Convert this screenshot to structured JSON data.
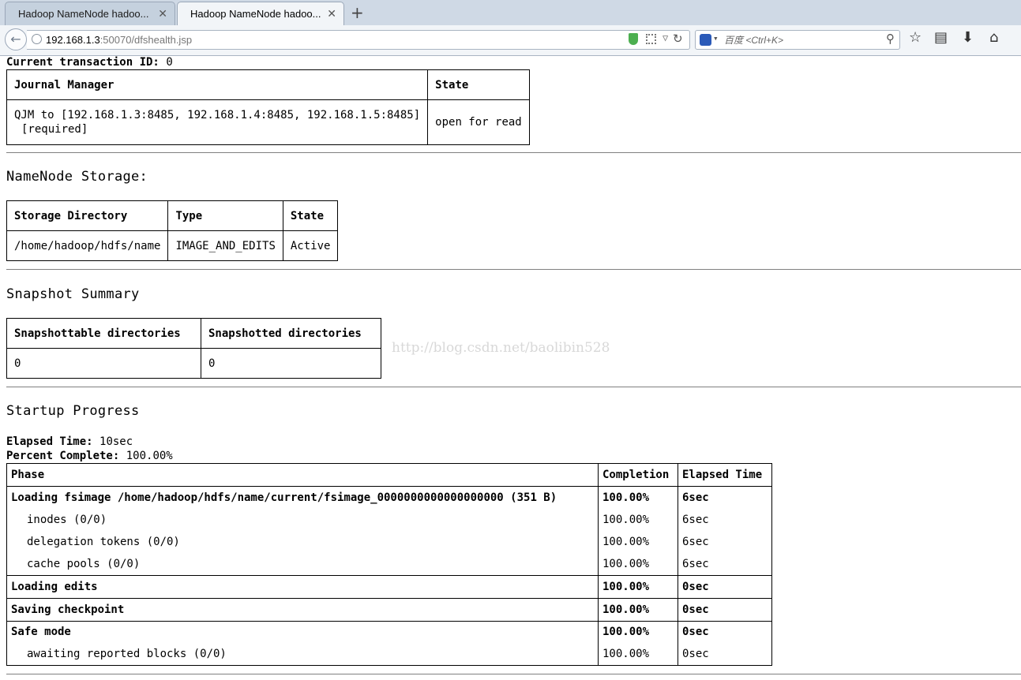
{
  "browser": {
    "tabs": [
      {
        "label": "Hadoop NameNode hadoo...",
        "active": false
      },
      {
        "label": "Hadoop NameNode hadoo...",
        "active": true
      }
    ],
    "close_glyph": "✕",
    "new_tab_glyph": "+",
    "url_host": "192.168.1.3",
    "url_rest": ":50070/dfshealth.jsp",
    "search_placeholder": "百度 <Ctrl+K>"
  },
  "page": {
    "transaction_label": "Current transaction ID:",
    "transaction_value": "0",
    "journal": {
      "headers": [
        "Journal Manager",
        "State"
      ],
      "rows": [
        {
          "manager_line1": "QJM to [192.168.1.3:8485, 192.168.1.4:8485, 192.168.1.5:8485]",
          "manager_line2": "[required]",
          "state": "open for read"
        }
      ]
    },
    "storage": {
      "title": "NameNode Storage:",
      "headers": [
        "Storage Directory",
        "Type",
        "State"
      ],
      "rows": [
        [
          "/home/hadoop/hdfs/name",
          "IMAGE_AND_EDITS",
          "Active"
        ]
      ]
    },
    "snapshot": {
      "title": "Snapshot Summary",
      "headers": [
        "Snapshottable directories",
        "Snapshotted directories"
      ],
      "rows": [
        [
          "0",
          "0"
        ]
      ]
    },
    "watermark": "http://blog.csdn.net/baolibin528",
    "startup": {
      "title": "Startup Progress",
      "elapsed_label": "Elapsed Time:",
      "elapsed_value": "10sec",
      "percent_label": "Percent Complete:",
      "percent_value": "100.00%",
      "headers": [
        "Phase",
        "Completion",
        "Elapsed Time"
      ],
      "phases": [
        {
          "name": "Loading fsimage /home/hadoop/hdfs/name/current/fsimage_0000000000000000000 (351 B)",
          "completion": "100.00%",
          "elapsed": "6sec"
        },
        {
          "name": "inodes (0/0)",
          "completion": "100.00%",
          "elapsed": "6sec"
        },
        {
          "name": "delegation tokens (0/0)",
          "completion": "100.00%",
          "elapsed": "6sec"
        },
        {
          "name": "cache pools (0/0)",
          "completion": "100.00%",
          "elapsed": "6sec"
        },
        {
          "name": "Loading edits",
          "completion": "100.00%",
          "elapsed": "0sec"
        },
        {
          "name": "Saving checkpoint",
          "completion": "100.00%",
          "elapsed": "0sec"
        },
        {
          "name": "Safe mode",
          "completion": "100.00%",
          "elapsed": "0sec"
        },
        {
          "name": "awaiting reported blocks (0/0)",
          "completion": "100.00%",
          "elapsed": "0sec"
        }
      ]
    }
  }
}
